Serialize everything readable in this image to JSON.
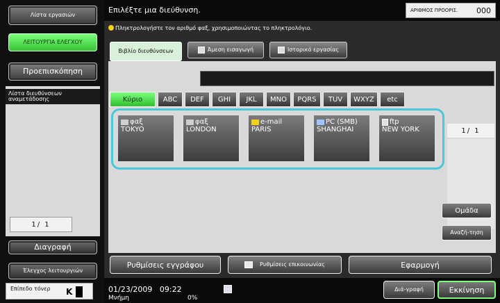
{
  "left_panel": {
    "job_list": "Λίστα εργασιών",
    "functions": "ΛΕΙΤΟΥΡΓΙΑ ΕΛΕΓΧΟΥ",
    "preview": "Προεπισκόπηση",
    "resend_list": "Λίστα διευθύνσεων αναμετάδοσης",
    "counter": "1/  1",
    "delete": "Διαγραφή",
    "job_control": "Έλεγχος λειτουργιών",
    "toner_label": "Επίπεδο τόνερ",
    "toner_color": "K"
  },
  "header": {
    "title": "Επιλέξτε μια διεύθυνση.",
    "originals_label": "ΑΡΙΘΜΟΣ ΠΡΟΟΡΙΣ.",
    "originals_value": "000",
    "hint": "Πληκτρολογήστε τον αριθμό φαξ, χρησιμοποιώντας το πληκτρολόγιο."
  },
  "tabs": {
    "address_book": "Βιβλίο διευθύνσεων",
    "direct_input": "Άμεση εισαγωγή",
    "job_history": "Ιστορικό εργασίας"
  },
  "filters": [
    "Κύριο",
    "ABC",
    "DEF",
    "GHI",
    "JKL",
    "MNO",
    "PQRS",
    "TUV",
    "WXYZ",
    "etc"
  ],
  "destinations": [
    {
      "type": "φαξ",
      "name": "TOKYO",
      "icon": "fax-icon"
    },
    {
      "type": "φαξ",
      "name": "LONDON",
      "icon": "fax-icon"
    },
    {
      "type": "e-mail",
      "name": "PARIS",
      "icon": "email-icon"
    },
    {
      "type": "PC (SMB)",
      "name": "SHANGHAI",
      "icon": "pc-icon"
    },
    {
      "type": "ftp",
      "name": "NEW YORK",
      "icon": "ftp-icon"
    }
  ],
  "page_count": "1/  1",
  "side_buttons": {
    "group": "Ομάδα",
    "search": "Αναζή-τηση"
  },
  "bottom": {
    "document_settings": "Ρυθμίσεις εγγράφου",
    "comm_settings": "Ρυθμίσεις επικοινωνίας",
    "apply": "Εφαρμογή"
  },
  "status": {
    "date": "01/23/2009",
    "time": "09:22",
    "memory": "Μνήμη",
    "memory_value": "0%",
    "review": "Διά-γραφή",
    "start": "Εκκίνηση"
  }
}
